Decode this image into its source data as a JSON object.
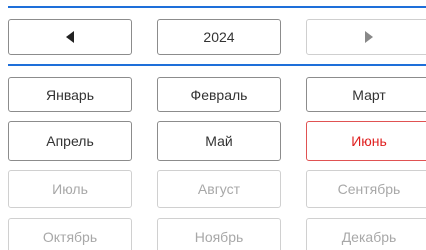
{
  "nav": {
    "prev_icon": "triangle-left-icon",
    "year": "2024",
    "next_icon": "triangle-right-icon"
  },
  "colors": {
    "accent_rule": "#1e6fd9",
    "current_month": "#e02020"
  },
  "months": [
    {
      "label": "Январь",
      "state": "past"
    },
    {
      "label": "Февраль",
      "state": "past"
    },
    {
      "label": "Март",
      "state": "past"
    },
    {
      "label": "Апрель",
      "state": "past"
    },
    {
      "label": "Май",
      "state": "past"
    },
    {
      "label": "Июнь",
      "state": "current"
    },
    {
      "label": "Июль",
      "state": "future"
    },
    {
      "label": "Август",
      "state": "future"
    },
    {
      "label": "Сентябрь",
      "state": "future"
    },
    {
      "label": "Октябрь",
      "state": "future"
    },
    {
      "label": "Ноябрь",
      "state": "future"
    },
    {
      "label": "Декабрь",
      "state": "future"
    }
  ]
}
